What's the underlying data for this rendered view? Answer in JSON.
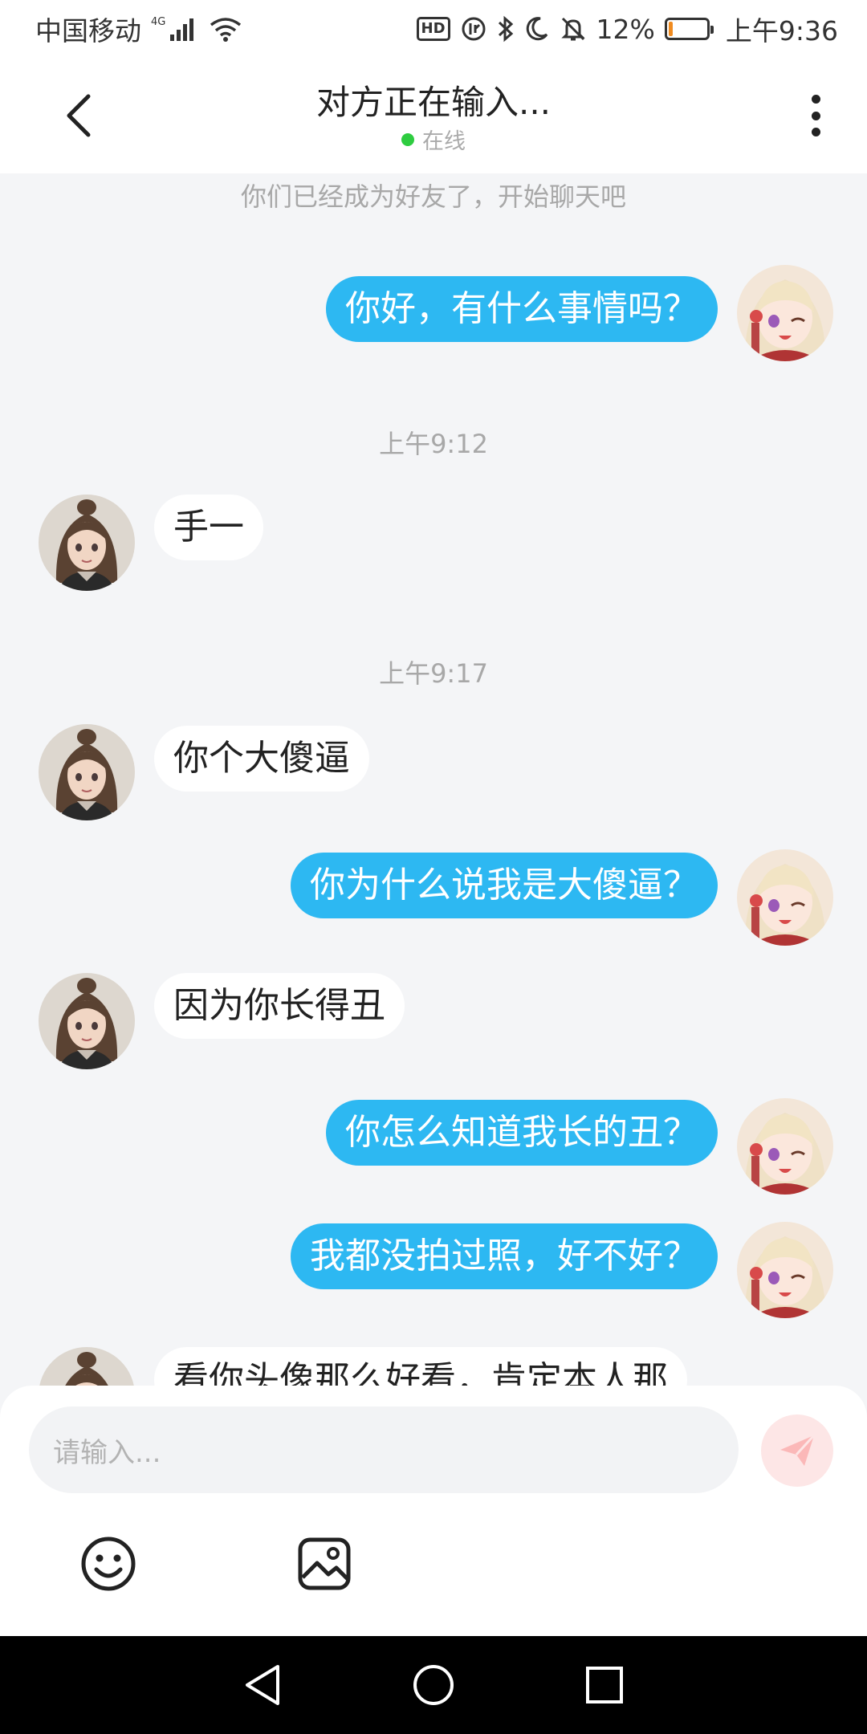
{
  "status_bar": {
    "carrier": "中国移动",
    "network": "4G",
    "battery_percent": "12%",
    "battery_level": 0.12,
    "time": "上午9:36",
    "hd_label": "HD",
    "icons": [
      "signal-icon",
      "wifi-icon",
      "hd-icon",
      "data-saver-icon",
      "bluetooth-icon",
      "moon-icon",
      "mute-icon",
      "battery-icon"
    ]
  },
  "header": {
    "title": "对方正在输入...",
    "status": "在线",
    "status_color": "#2ecc40"
  },
  "chat": {
    "system_note": "你们已经成为好友了，开始聊天吧",
    "time_1": "上午9:12",
    "time_2": "上午9:17",
    "messages": [
      {
        "side": "right",
        "text": "你好，有什么事情吗？"
      },
      {
        "side": "left",
        "text": "手一"
      },
      {
        "side": "left",
        "text": "你个大傻逼"
      },
      {
        "side": "right",
        "text": "你为什么说我是大傻逼？"
      },
      {
        "side": "left",
        "text": "因为你长得丑"
      },
      {
        "side": "right",
        "text": "你怎么知道我长的丑？"
      },
      {
        "side": "right",
        "text": "我都没拍过照，好不好？"
      },
      {
        "side": "left",
        "text": "看你头像那么好看，肯定本人那"
      }
    ]
  },
  "input": {
    "placeholder": "请输入..."
  },
  "colors": {
    "outgoing_bubble": "#2db8f2",
    "incoming_bubble": "#ffffff",
    "background": "#f4f5f7",
    "send_button": "#fde6e6"
  }
}
